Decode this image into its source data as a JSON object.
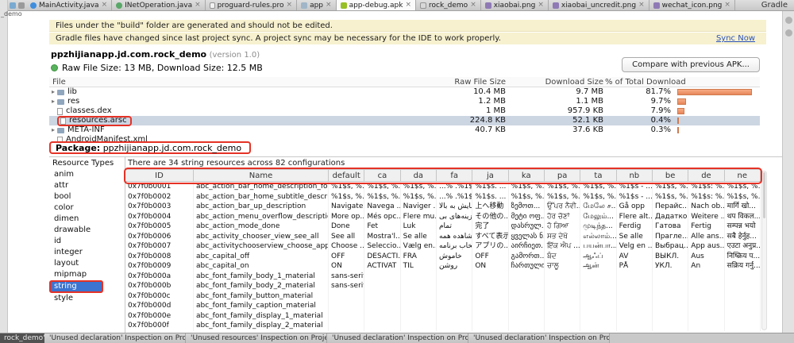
{
  "colors": {
    "banner_yellow": "#f7f1cf",
    "link_blue": "#2a52bc",
    "selection_blue": "#3b74d1",
    "bar_orange": "#e8865a",
    "annotation_red": "#e53226"
  },
  "left_strip": {
    "label": "_demo"
  },
  "tab_bar": {
    "tabs": [
      {
        "label": "MainActivity.java",
        "icon": "java-class",
        "selected": false
      },
      {
        "label": "INetOperation.java",
        "icon": "java-interface",
        "selected": false
      },
      {
        "label": "proguard-rules.pro",
        "icon": "text-file",
        "selected": false
      },
      {
        "label": "app",
        "icon": "module",
        "selected": false
      },
      {
        "label": "app-debug.apk",
        "icon": "android",
        "selected": true
      },
      {
        "label": "rock_demo",
        "icon": "file",
        "selected": false
      },
      {
        "label": "xiaobai.png",
        "icon": "image",
        "selected": false
      },
      {
        "label": "xiaobai_uncredit.png",
        "icon": "image",
        "selected": false
      },
      {
        "label": "wechat_icon.png",
        "icon": "image",
        "selected": false
      }
    ],
    "right_label": "Gradle"
  },
  "banners": [
    {
      "text": "Files under the \"build\" folder are generated and should not be edited."
    },
    {
      "text": "Gradle files have changed since last project sync. A project sync may be necessary for the IDE to work properly.",
      "action": "Sync Now"
    }
  ],
  "apk_info": {
    "package_title": "ppzhijianapp.jd.com.rock_demo",
    "version": "(version 1.0)",
    "size_line": "Raw File Size: 13 MB, Download Size: 12.5 MB",
    "compare_button": "Compare with previous APK..."
  },
  "file_table": {
    "columns": [
      "File",
      "Raw File Size",
      "Download Size",
      "% of Total Download"
    ],
    "rows": [
      {
        "name": "lib",
        "type": "folder",
        "raw": "10.4 MB",
        "download": "9.7 MB",
        "percent": "81.7%",
        "bar": 81.7
      },
      {
        "name": "res",
        "type": "folder",
        "raw": "1.2 MB",
        "download": "1.1 MB",
        "percent": "9.7%",
        "bar": 9.7
      },
      {
        "name": "classes.dex",
        "type": "file",
        "raw": "1 MB",
        "download": "957.9 KB",
        "percent": "7.9%",
        "bar": 7.9
      },
      {
        "name": "resources.arsc",
        "type": "file",
        "raw": "224.8 KB",
        "download": "52.1 KB",
        "percent": "0.4%",
        "bar": 0.4,
        "selected": true,
        "annotated": true
      },
      {
        "name": "META-INF",
        "type": "folder",
        "raw": "40.7 KB",
        "download": "37.6 KB",
        "percent": "0.3%",
        "bar": 0.3
      },
      {
        "name": "AndroidManifest.xml",
        "type": "file",
        "raw": "",
        "download": "",
        "percent": "",
        "bar": 0
      }
    ]
  },
  "package_line": {
    "label": "Package:",
    "value": "ppzhijianapp.jd.com.rock_demo"
  },
  "resource_types": {
    "title": "Resource Types",
    "items": [
      "anim",
      "attr",
      "bool",
      "color",
      "dimen",
      "drawable",
      "id",
      "integer",
      "layout",
      "mipmap",
      "string",
      "style"
    ],
    "selected": "string"
  },
  "string_panel": {
    "summary": "There are 34 string resources across 82 configurations",
    "columns": [
      "ID",
      "Name",
      "default",
      "ca",
      "da",
      "fa",
      "ja",
      "ka",
      "pa",
      "ta",
      "nb",
      "be",
      "de",
      "ne"
    ],
    "rows": [
      [
        "0x7f0b0001",
        "abc_action_bar_home_description_fo...",
        "%1$s, %...",
        "%1$s, %...",
        "%1$s, %...",
        "...% .%1$s",
        "%1$s. ...",
        "%1$s, %...",
        "%1$s, %...",
        "%1$s, %...",
        "%1$s - ...",
        "%1$s, %...",
        "%1$s: %...",
        "%1$s, %..."
      ],
      [
        "0x7f0b0002",
        "abc_action_bar_home_subtitle_descri...",
        "%1$s, %...",
        "%1$s, %...",
        "%1$s, %...",
        "...% .%1$s",
        "%1$s. ...",
        "%1$s, %...",
        "%1$s, %...",
        "%1$s, %...",
        "%1$s - ...",
        "%1$s, %...",
        "%1$s: %...",
        "%1$s, %..."
      ],
      [
        "0x7f0b0003",
        "abc_action_bar_up_description",
        "Navigate...",
        "Navega ...",
        "Naviger ...",
        "پیمایش به بالا",
        "上へ移動",
        "ზემოთ...",
        "ਉੱਪਰ ਨੈਵੀ...",
        "மேலே ச...",
        "Gå opp",
        "Перайс...",
        "Nach ob...",
        "मार्गि खो..."
      ],
      [
        "0x7f0b0004",
        "abc_action_menu_overflow_description",
        "More op...",
        "Més opc...",
        "Flere mu...",
        "گزینه‌های بی...",
        "その他の...",
        "მეტი ოფ...",
        "ਹੋਰ ਚੋਣਾਂ",
        "மேலும்...",
        "Flere alt...",
        "Дадатко...",
        "Weitere ...",
        "थप विकल..."
      ],
      [
        "0x7f0b0005",
        "abc_action_mode_done",
        "Done",
        "Fet",
        "Luk",
        "تمام",
        "完了",
        "დასრულ...",
        "ਹੋ ਗਿਆ",
        "முடிந்த...",
        "Ferdig",
        "Гатова",
        "Fertig",
        "सम्पन्न भयो"
      ],
      [
        "0x7f0b0006",
        "abc_activity_chooser_view_see_all",
        "See all",
        "Mostra'l...",
        "Se alle",
        "مشاهده همه",
        "すべて表示",
        "ყველას ნ...",
        "ਸਭ ਦੇਖੋ",
        "எல்லாம்...",
        "Se alle",
        "Прагле...",
        "Alle ans...",
        "सबै हेर्नुह..."
      ],
      [
        "0x7f0b0007",
        "abc_activitychooserview_choose_app...",
        "Choose ...",
        "Seleccio...",
        "Vælg en...",
        "انتخاب برنامه",
        "アプリの...",
        "აირჩიეთ...",
        "ਇੱਕ ਐਪ ...",
        "பயன்பா...",
        "Velg en ...",
        "Выбрац...",
        "App aus...",
        "एउटा अनुप्र..."
      ],
      [
        "0x7f0b0008",
        "abc_capital_off",
        "OFF",
        "DESACTI...",
        "FRA",
        "خاموش",
        "OFF",
        "გამორთ...",
        "ਬੰਦ",
        "ஆஃப்",
        "AV",
        "ВЫКЛ.",
        "Aus",
        "निष्क्रिय प..."
      ],
      [
        "0x7f0b0009",
        "abc_capital_on",
        "ON",
        "ACTIVAT",
        "TIL",
        "روشن",
        "ON",
        "ჩართულია",
        "ਚਾਲੂ",
        "ஆன்",
        "PÅ",
        "УКЛ.",
        "An",
        "सक्रिय गर्नु..."
      ],
      [
        "0x7f0b000a",
        "abc_font_family_body_1_material",
        "sans-serif",
        "",
        "",
        "",
        "",
        "",
        "",
        "",
        "",
        "",
        "",
        ""
      ],
      [
        "0x7f0b000b",
        "abc_font_family_body_2_material",
        "sans-serif",
        "",
        "",
        "",
        "",
        "",
        "",
        "",
        "",
        "",
        "",
        ""
      ],
      [
        "0x7f0b000c",
        "abc_font_family_button_material",
        "",
        "",
        "",
        "",
        "",
        "",
        "",
        "",
        "",
        "",
        "",
        ""
      ],
      [
        "0x7f0b000d",
        "abc_font_family_caption_material",
        "",
        "",
        "",
        "",
        "",
        "",
        "",
        "",
        "",
        "",
        "",
        ""
      ],
      [
        "0x7f0b000e",
        "abc_font_family_display_1_material",
        "",
        "",
        "",
        "",
        "",
        "",
        "",
        "",
        "",
        "",
        "",
        ""
      ],
      [
        "0x7f0b000f",
        "abc_font_family_display_2_material",
        "",
        "",
        "",
        "",
        "",
        "",
        "",
        "",
        "",
        "",
        "",
        ""
      ]
    ]
  },
  "bottom_bar": {
    "left_tab": "rock_demo'",
    "tabs": [
      "'Unused declaration' Inspection on Project 'rock_demo'",
      "'Unused resources' Inspection on Project 'rock_demo'",
      "'Unused declaration' Inspection on Project 'rock_demo'",
      "'Unused declaration' Inspection on Project 'rock_demo'"
    ]
  }
}
